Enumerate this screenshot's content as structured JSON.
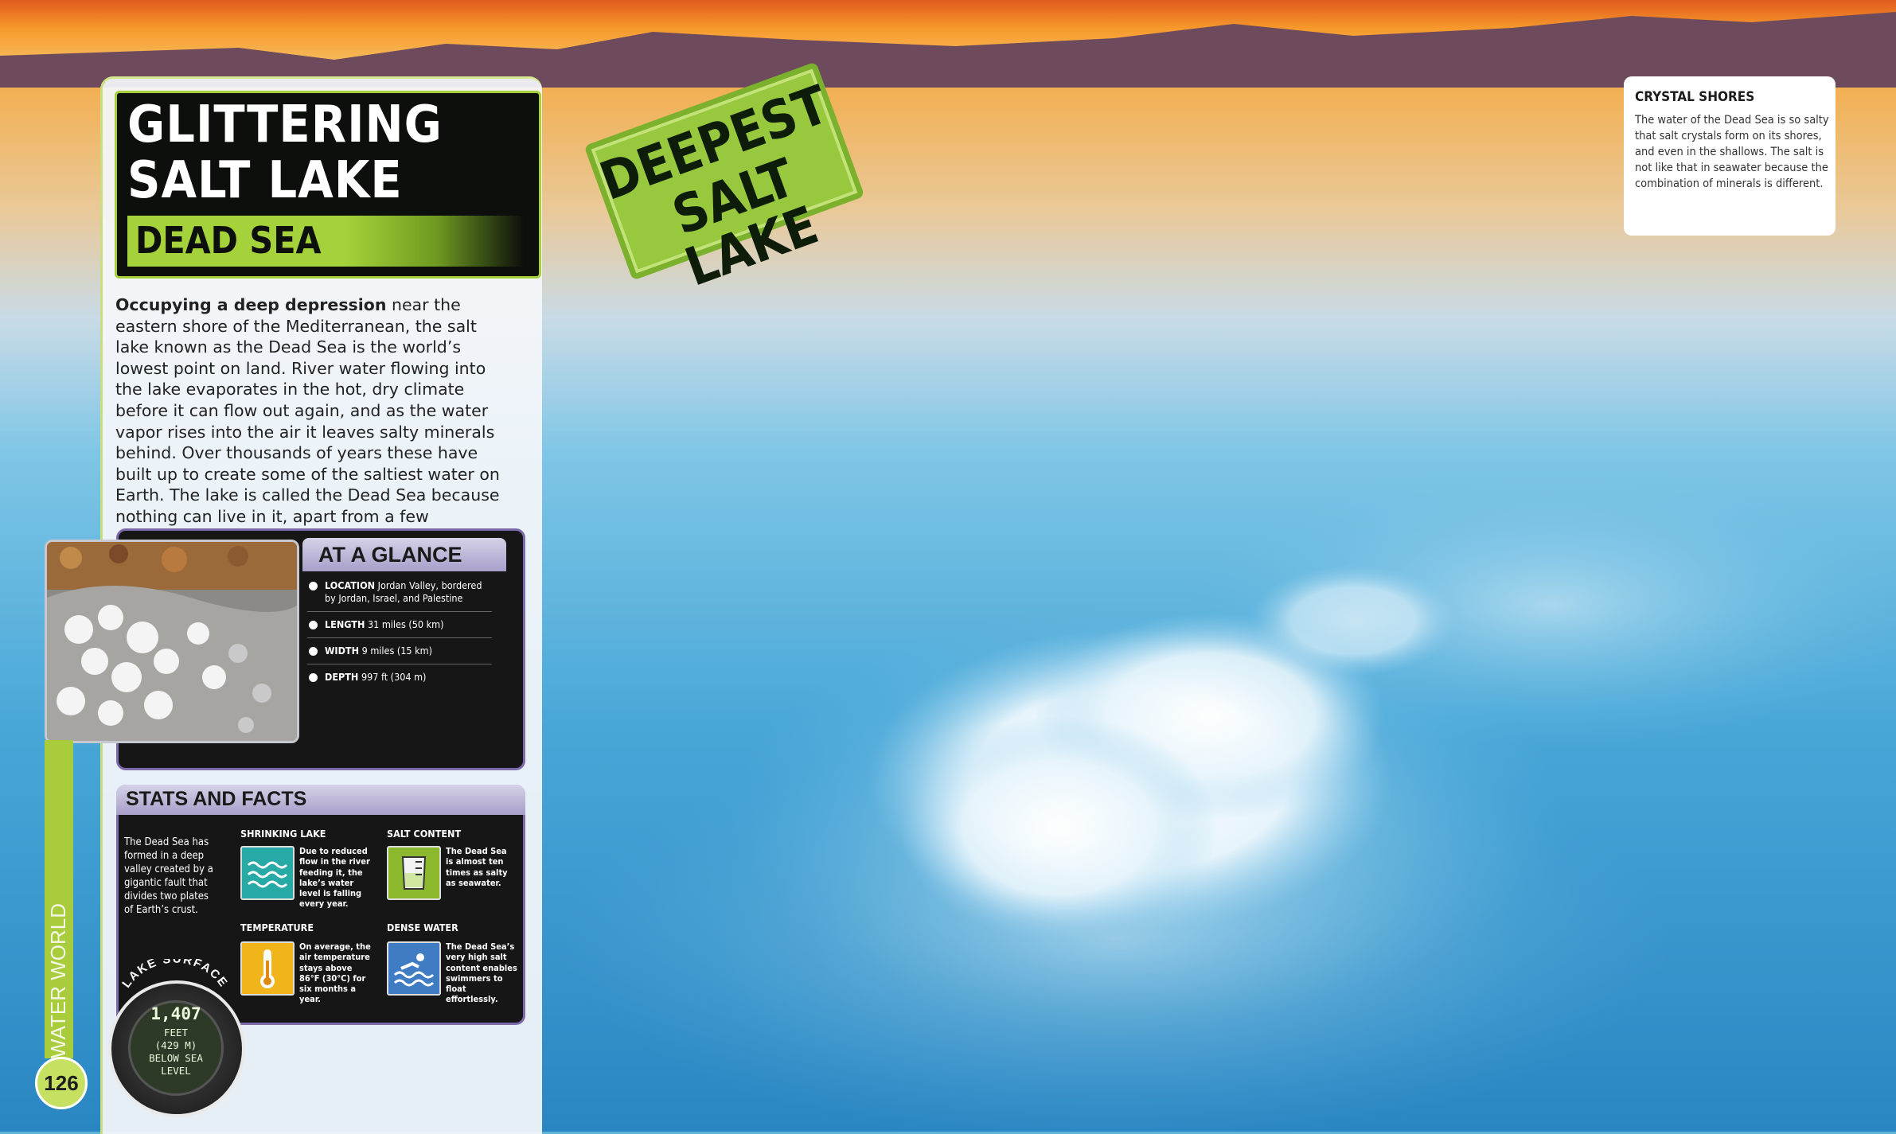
{
  "title": "GLITTERING SALT LAKE",
  "subtitle": "DEAD SEA",
  "intro": {
    "lead": "Occupying a deep depression",
    "text": " near the eastern shore of the Mediterranean, the salt lake known as the Dead Sea is the world’s lowest point on land. River water flowing into the lake evaporates in the hot, dry climate before it can flow out again, and as the water vapor rises into the air it leaves salty minerals behind. Over thousands of years these have built up to create some of the saltiest water on Earth. The lake is called the Dead Sea because nothing can live in it, apart from a few specialized salt-loving microbes."
  },
  "stamp": {
    "line1": "DEEPEST",
    "line2": "SALT LAKE"
  },
  "caption": {
    "title": "CRYSTAL SHORES",
    "text": "The water of the Dead Sea is so salty that salt crystals form on its shores, and even in the shallows. The salt is not like that in seawater because the combination of minerals is different."
  },
  "glance": {
    "title": "AT A GLANCE",
    "items": [
      {
        "key": "LOCATION",
        "value": "Jordan Valley, bordered by Jordan, Israel, and Palestine"
      },
      {
        "key": "LENGTH",
        "value": "31 miles (50 km)"
      },
      {
        "key": "WIDTH",
        "value": "9 miles (15 km)"
      },
      {
        "key": "DEPTH",
        "value": "997 ft (304 m)"
      }
    ]
  },
  "stats": {
    "title": "STATS AND FACTS",
    "note": "The Dead Sea has formed in a deep valley created by a gigantic fault that divides two plates of Earth’s crust.",
    "facts": [
      {
        "heading": "SHRINKING LAKE",
        "text": "Due to reduced flow in the river feeding it, the lake’s water level is falling every year.",
        "icon": "waves-icon",
        "color": "#27a9a6"
      },
      {
        "heading": "SALT CONTENT",
        "text": "The Dead Sea is almost ten times as salty as seawater.",
        "icon": "beaker-icon",
        "color": "#8bb82c"
      },
      {
        "heading": "TEMPERATURE",
        "text": "On average, the air temperature stays above 86°F (30°C) for six months a year.",
        "icon": "thermometer-icon",
        "color": "#f0b51a"
      },
      {
        "heading": "DENSE WATER",
        "text": "The Dead Sea’s very high salt content enables swimmers to float effortlessly.",
        "icon": "swimmer-icon",
        "color": "#3f7cc4"
      }
    ]
  },
  "gauge": {
    "arc_label": "LAKE SURFACE",
    "value": "1,407",
    "sub": "FEET\n(429 M)\nBELOW SEA\nLEVEL"
  },
  "section": "WATER WORLD",
  "page_number": "126"
}
